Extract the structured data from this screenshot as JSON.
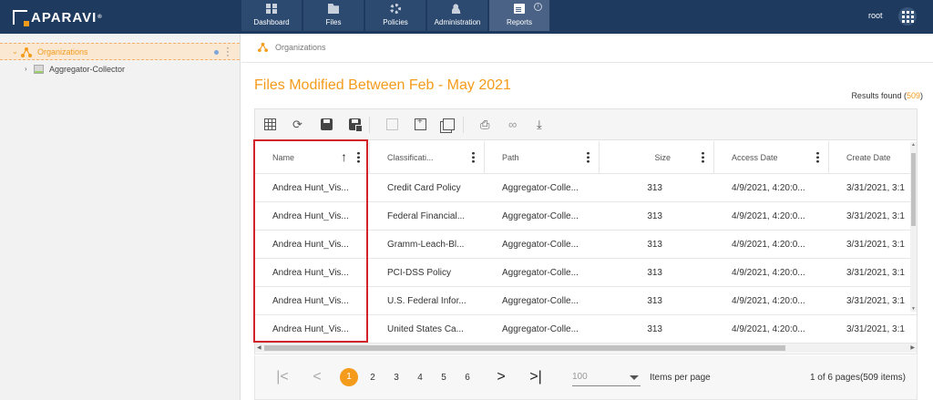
{
  "brand": {
    "name": "APARAVI",
    "reg": "®"
  },
  "nav": [
    {
      "label": "Dashboard",
      "icon": "dashboard-icon"
    },
    {
      "label": "Files",
      "icon": "folder-icon"
    },
    {
      "label": "Policies",
      "icon": "gear-icon"
    },
    {
      "label": "Administration",
      "icon": "users-icon"
    },
    {
      "label": "Reports",
      "icon": "clipboard-icon",
      "active": true
    }
  ],
  "info_badge": "i",
  "user": {
    "name": "root"
  },
  "sidebar": {
    "items": [
      {
        "label": "Organizations",
        "icon": "org-tree-icon",
        "selected": true
      },
      {
        "label": "Aggregator-Collector",
        "icon": "collector-icon"
      }
    ]
  },
  "breadcrumb": {
    "label": "Organizations"
  },
  "report": {
    "title": "Files Modified Between Feb - May 2021",
    "results_prefix": "Results found (",
    "results_count": "509",
    "results_suffix": ")"
  },
  "toolbar": [
    "grid-icon",
    "refresh-icon",
    "save-icon",
    "save-as-icon",
    "split-icon",
    "add-window-icon",
    "copy-window-icon",
    "print-icon",
    "link-icon",
    "download-icon"
  ],
  "table": {
    "columns": [
      "Name",
      "Classificati...",
      "Path",
      "Size",
      "Access Date",
      "Create Date"
    ],
    "rows": [
      [
        "Andrea Hunt_Vis...",
        "Credit Card Policy",
        "Aggregator-Colle...",
        "313",
        "4/9/2021, 4:20:0...",
        "3/31/2021, 3:1"
      ],
      [
        "Andrea Hunt_Vis...",
        "Federal Financial...",
        "Aggregator-Colle...",
        "313",
        "4/9/2021, 4:20:0...",
        "3/31/2021, 3:1"
      ],
      [
        "Andrea Hunt_Vis...",
        "Gramm-Leach-Bl...",
        "Aggregator-Colle...",
        "313",
        "4/9/2021, 4:20:0...",
        "3/31/2021, 3:1"
      ],
      [
        "Andrea Hunt_Vis...",
        "PCI-DSS Policy",
        "Aggregator-Colle...",
        "313",
        "4/9/2021, 4:20:0...",
        "3/31/2021, 3:1"
      ],
      [
        "Andrea Hunt_Vis...",
        "U.S. Federal Infor...",
        "Aggregator-Colle...",
        "313",
        "4/9/2021, 4:20:0...",
        "3/31/2021, 3:1"
      ],
      [
        "Andrea Hunt_Vis...",
        "United States Ca...",
        "Aggregator-Colle...",
        "313",
        "4/9/2021, 4:20:0...",
        "3/31/2021, 3:1"
      ]
    ]
  },
  "pager": {
    "first": "|<",
    "prev": "<",
    "pages": [
      "1",
      "2",
      "3",
      "4",
      "5",
      "6"
    ],
    "current": "1",
    "next": ">",
    "last": ">|",
    "per_page_value": "100",
    "per_page_label": "Items per page",
    "info": "1 of 6 pages(509 items)"
  }
}
